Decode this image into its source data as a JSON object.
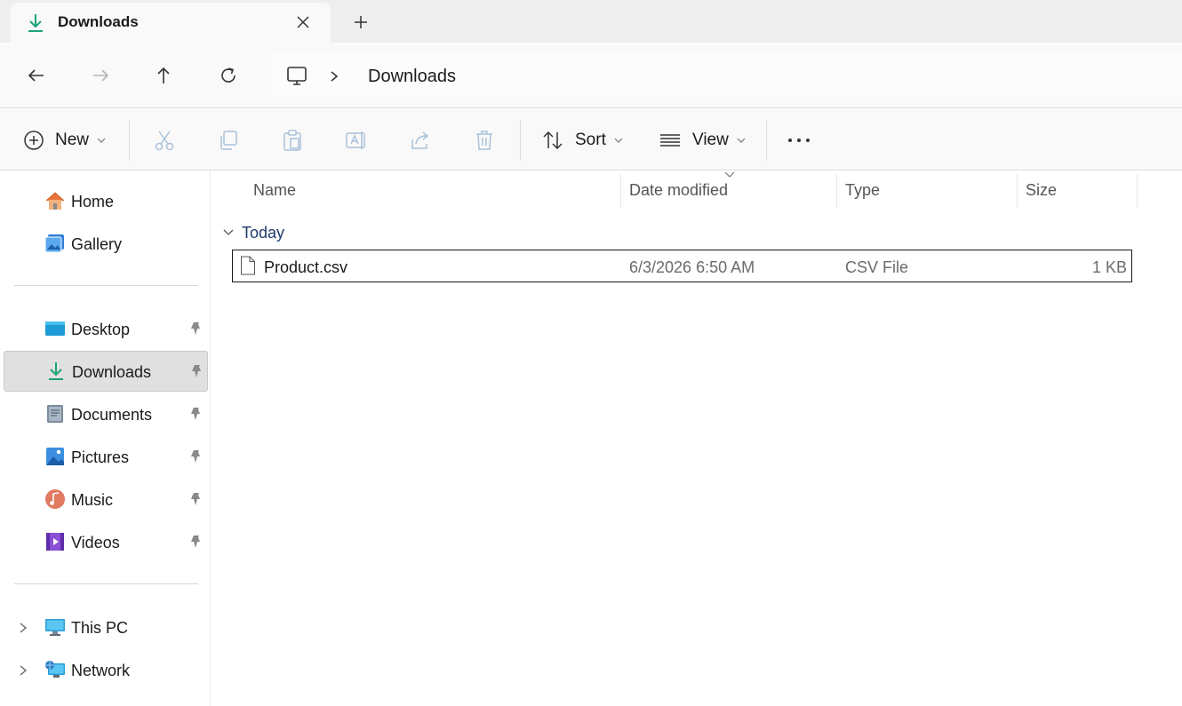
{
  "tab": {
    "title": "Downloads",
    "close_label": "Close tab",
    "new_tab_label": "New tab"
  },
  "address": {
    "breadcrumb": [
      "Downloads"
    ]
  },
  "toolbar": {
    "new_label": "New",
    "sort_label": "Sort",
    "view_label": "View",
    "icons": [
      "cut-icon",
      "copy-icon",
      "paste-icon",
      "rename-icon",
      "share-icon",
      "delete-icon",
      "more-icon"
    ]
  },
  "sidebar": {
    "quick": [
      {
        "label": "Home",
        "icon": "home-icon"
      },
      {
        "label": "Gallery",
        "icon": "gallery-icon"
      }
    ],
    "pinned": [
      {
        "label": "Desktop",
        "icon": "desktop-folder-icon"
      },
      {
        "label": "Downloads",
        "icon": "downloads-folder-icon",
        "selected": true
      },
      {
        "label": "Documents",
        "icon": "documents-folder-icon"
      },
      {
        "label": "Pictures",
        "icon": "pictures-folder-icon"
      },
      {
        "label": "Music",
        "icon": "music-folder-icon"
      },
      {
        "label": "Videos",
        "icon": "videos-folder-icon"
      }
    ],
    "locations": [
      {
        "label": "This PC",
        "icon": "this-pc-icon"
      },
      {
        "label": "Network",
        "icon": "network-icon"
      }
    ]
  },
  "columns": {
    "name": "Name",
    "date": "Date modified",
    "type": "Type",
    "size": "Size"
  },
  "groups": [
    {
      "label": "Today",
      "files": [
        {
          "name": "Product.csv",
          "date": "6/3/2026 6:50 AM",
          "type": "CSV File",
          "size": "1 KB"
        }
      ]
    }
  ]
}
